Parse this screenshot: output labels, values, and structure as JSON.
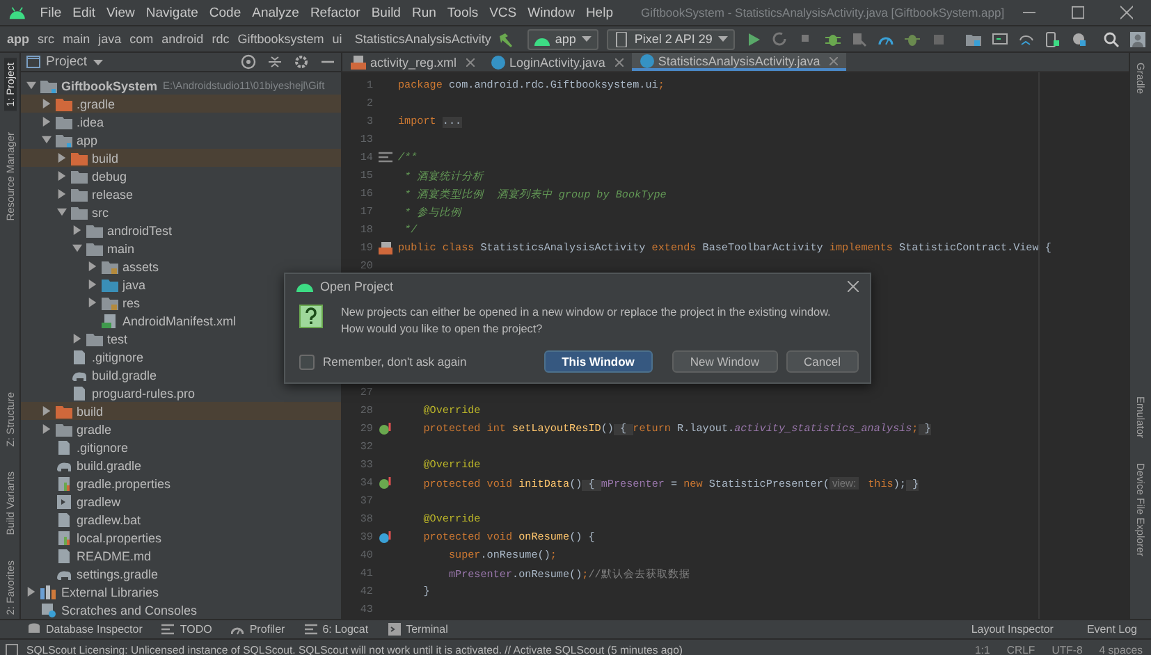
{
  "window": {
    "title": "GiftbookSystem - StatisticsAnalysisActivity.java [GiftbookSystem.app]"
  },
  "menu": [
    "File",
    "Edit",
    "View",
    "Navigate",
    "Code",
    "Analyze",
    "Refactor",
    "Build",
    "Run",
    "Tools",
    "VCS",
    "Window",
    "Help"
  ],
  "breadcrumbs": [
    "app",
    "src",
    "main",
    "java",
    "com",
    "android",
    "rdc",
    "Giftbooksystem",
    "ui",
    "StatisticsAnalysisActivity"
  ],
  "toolbar": {
    "module": "app",
    "device": "Pixel 2 API 29"
  },
  "left_strip": [
    {
      "label": "1: Project",
      "selected": true
    },
    {
      "label": "Resource Manager",
      "selected": false
    },
    {
      "label": "Z: Structure",
      "selected": false
    },
    {
      "label": "Build Variants",
      "selected": false
    },
    {
      "label": "2: Favorites",
      "selected": false
    }
  ],
  "right_strip": [
    {
      "label": "Gradle"
    },
    {
      "label": "Emulator"
    },
    {
      "label": "Device File Explorer"
    }
  ],
  "project_panel": {
    "title": "Project",
    "tree": [
      {
        "name": "GiftbookSystem",
        "path": "E:\\Androidstudio11\\01biyeshejl\\Gift",
        "kind": "module",
        "expanded": true,
        "children": [
          {
            "name": ".gradle",
            "kind": "excluded",
            "expanded": false
          },
          {
            "name": ".idea",
            "kind": "folder",
            "expanded": false
          },
          {
            "name": "app",
            "kind": "module",
            "expanded": true,
            "children": [
              {
                "name": "build",
                "kind": "excluded",
                "expanded": false
              },
              {
                "name": "debug",
                "kind": "folder",
                "expanded": false
              },
              {
                "name": "release",
                "kind": "folder",
                "expanded": false
              },
              {
                "name": "src",
                "kind": "folder",
                "expanded": true,
                "children": [
                  {
                    "name": "androidTest",
                    "kind": "folder",
                    "expanded": false
                  },
                  {
                    "name": "main",
                    "kind": "folder",
                    "expanded": true,
                    "children": [
                      {
                        "name": "assets",
                        "kind": "resources",
                        "expanded": false
                      },
                      {
                        "name": "java",
                        "kind": "source",
                        "expanded": false
                      },
                      {
                        "name": "res",
                        "kind": "resources",
                        "expanded": false
                      },
                      {
                        "name": "AndroidManifest.xml",
                        "kind": "manifest"
                      }
                    ]
                  },
                  {
                    "name": "test",
                    "kind": "folder",
                    "expanded": false
                  }
                ]
              },
              {
                "name": ".gitignore",
                "kind": "file"
              },
              {
                "name": "build.gradle",
                "kind": "gradle"
              },
              {
                "name": "proguard-rules.pro",
                "kind": "file"
              }
            ]
          },
          {
            "name": "build",
            "kind": "excluded",
            "expanded": false
          },
          {
            "name": "gradle",
            "kind": "folder",
            "expanded": false
          },
          {
            "name": ".gitignore",
            "kind": "file"
          },
          {
            "name": "build.gradle",
            "kind": "gradle"
          },
          {
            "name": "gradle.properties",
            "kind": "properties"
          },
          {
            "name": "gradlew",
            "kind": "script"
          },
          {
            "name": "gradlew.bat",
            "kind": "file"
          },
          {
            "name": "local.properties",
            "kind": "properties"
          },
          {
            "name": "README.md",
            "kind": "file"
          },
          {
            "name": "settings.gradle",
            "kind": "gradle"
          }
        ]
      },
      {
        "name": "External Libraries",
        "kind": "libraries",
        "expanded": false
      },
      {
        "name": "Scratches and Consoles",
        "kind": "scratches"
      }
    ]
  },
  "editor_tabs": [
    {
      "label": "activity_reg.xml",
      "kind": "xml",
      "selected": false
    },
    {
      "label": "LoginActivity.java",
      "kind": "class",
      "selected": false
    },
    {
      "label": "StatisticsAnalysisActivity.java",
      "kind": "class",
      "selected": true
    }
  ],
  "code_above": [
    {
      "number": "1",
      "kind": "plain",
      "tokens": [
        {
          "kind": "kw",
          "text": "package"
        },
        {
          "kind": "plain",
          "text": " com.android.rdc.Giftbooksystem.ui"
        },
        {
          "kind": "kw",
          "text": ";"
        }
      ]
    },
    {
      "number": "2",
      "kind": "plain"
    },
    {
      "number": "3",
      "kind": "plain",
      "tokens": [
        {
          "kind": "kw",
          "text": "import "
        },
        {
          "kind": "fold",
          "text": "..."
        }
      ]
    },
    {
      "number": "13",
      "kind": "plain"
    },
    {
      "number": "14",
      "kind": "doc",
      "tokens": [
        {
          "kind": "doc",
          "text": "/**"
        }
      ]
    },
    {
      "number": "15",
      "kind": "plain",
      "tokens": [
        {
          "kind": "doc",
          "text": " * 酒宴统计分析"
        }
      ]
    },
    {
      "number": "16",
      "kind": "plain",
      "tokens": [
        {
          "kind": "doc",
          "text": " * 酒宴类型比例  酒宴列表中 group by BookType"
        }
      ]
    },
    {
      "number": "17",
      "kind": "plain",
      "tokens": [
        {
          "kind": "doc",
          "text": " * 参与比例"
        }
      ]
    },
    {
      "number": "18",
      "kind": "plain",
      "tokens": [
        {
          "kind": "doc",
          "text": " */"
        }
      ]
    },
    {
      "number": "19",
      "kind": "layout",
      "tokens": [
        {
          "kind": "kw",
          "text": "public class "
        },
        {
          "kind": "plain",
          "text": "StatisticsAnalysisActivity "
        },
        {
          "kind": "kw",
          "text": "extends "
        },
        {
          "kind": "plain",
          "text": "BaseToolbarActivity "
        },
        {
          "kind": "kw",
          "text": "implements "
        },
        {
          "kind": "plain",
          "text": "StatisticContract.View {"
        }
      ]
    },
    {
      "number": "20",
      "kind": "plain"
    }
  ],
  "code_below": [
    {
      "number": "27",
      "kind": "plain"
    },
    {
      "number": "28",
      "kind": "plain",
      "tokens": [
        {
          "kind": "annot",
          "text": "    @Override"
        }
      ]
    },
    {
      "number": "29",
      "kind": "override",
      "tokens": [
        {
          "kind": "kw",
          "text": "    protected int "
        },
        {
          "kind": "method",
          "text": "setLayoutResID"
        },
        {
          "kind": "plain",
          "text": "()"
        },
        {
          "kind": "fold",
          "text": " { "
        },
        {
          "kind": "kw",
          "text": "return "
        },
        {
          "kind": "plain",
          "text": "R.layout."
        },
        {
          "kind": "field-italic",
          "text": "activity_statistics_analysis"
        },
        {
          "kind": "kw",
          "text": ";"
        },
        {
          "kind": "fold",
          "text": " }"
        }
      ]
    },
    {
      "number": "32",
      "kind": "plain"
    },
    {
      "number": "33",
      "kind": "plain",
      "tokens": [
        {
          "kind": "annot",
          "text": "    @Override"
        }
      ]
    },
    {
      "number": "34",
      "kind": "override",
      "tokens": [
        {
          "kind": "kw",
          "text": "    protected void "
        },
        {
          "kind": "method",
          "text": "initData"
        },
        {
          "kind": "plain",
          "text": "()"
        },
        {
          "kind": "fold",
          "text": " { "
        },
        {
          "kind": "field",
          "text": "mPresenter"
        },
        {
          "kind": "plain",
          "text": " = "
        },
        {
          "kind": "kw",
          "text": "new "
        },
        {
          "kind": "plain",
          "text": "StatisticPresenter("
        },
        {
          "kind": "hint",
          "text": "view:"
        },
        {
          "kind": "kw",
          "text": " this"
        },
        {
          "kind": "plain",
          "text": ");"
        },
        {
          "kind": "fold",
          "text": " }"
        }
      ]
    },
    {
      "number": "37",
      "kind": "plain"
    },
    {
      "number": "38",
      "kind": "plain",
      "tokens": [
        {
          "kind": "annot",
          "text": "    @Override"
        }
      ]
    },
    {
      "number": "39",
      "kind": "implement",
      "tokens": [
        {
          "kind": "kw",
          "text": "    protected void "
        },
        {
          "kind": "method",
          "text": "onResume"
        },
        {
          "kind": "plain",
          "text": "() {"
        }
      ]
    },
    {
      "number": "40",
      "kind": "plain",
      "tokens": [
        {
          "kind": "kw",
          "text": "        super"
        },
        {
          "kind": "plain",
          "text": ".onResume()"
        },
        {
          "kind": "kw",
          "text": ";"
        }
      ]
    },
    {
      "number": "41",
      "kind": "plain",
      "tokens": [
        {
          "kind": "field",
          "text": "        mPresenter"
        },
        {
          "kind": "plain",
          "text": ".onResume()"
        },
        {
          "kind": "kw",
          "text": ";"
        },
        {
          "kind": "comment",
          "text": "//默认会去获取数据"
        }
      ]
    },
    {
      "number": "42",
      "kind": "plain",
      "tokens": [
        {
          "kind": "plain",
          "text": "    }"
        }
      ]
    },
    {
      "number": "43",
      "kind": "plain"
    }
  ],
  "dialog": {
    "title": "Open Project",
    "message": [
      "New projects can either be opened in a new window or replace the project in the existing window.",
      "How would you like to open the project?"
    ],
    "checkbox": {
      "label": "Remember, don't ask again",
      "checked": false
    },
    "buttons": [
      {
        "label": "This Window",
        "selected": true
      },
      {
        "label": "New Window",
        "selected": false
      },
      {
        "label": "Cancel",
        "selected": false
      }
    ]
  },
  "bottom_tools": [
    {
      "label": "Database Inspector",
      "kind": "database"
    },
    {
      "label": "TODO",
      "kind": "list"
    },
    {
      "label": "Profiler",
      "kind": "gauge"
    },
    {
      "label": "6: Logcat",
      "kind": "list"
    },
    {
      "label": "Terminal",
      "kind": "terminal"
    }
  ],
  "bottom_tools_right": [
    {
      "label": "Layout Inspector"
    },
    {
      "label": "Event Log"
    }
  ],
  "status_bar": {
    "message": "SQLScout Licensing: Unlicensed instance of SQLScout. SQLScout will not work until it is activated. // Activate SQLScout (5 minutes ago)",
    "items": [
      "1:1",
      "CRLF",
      "UTF-8",
      "4 spaces"
    ]
  }
}
